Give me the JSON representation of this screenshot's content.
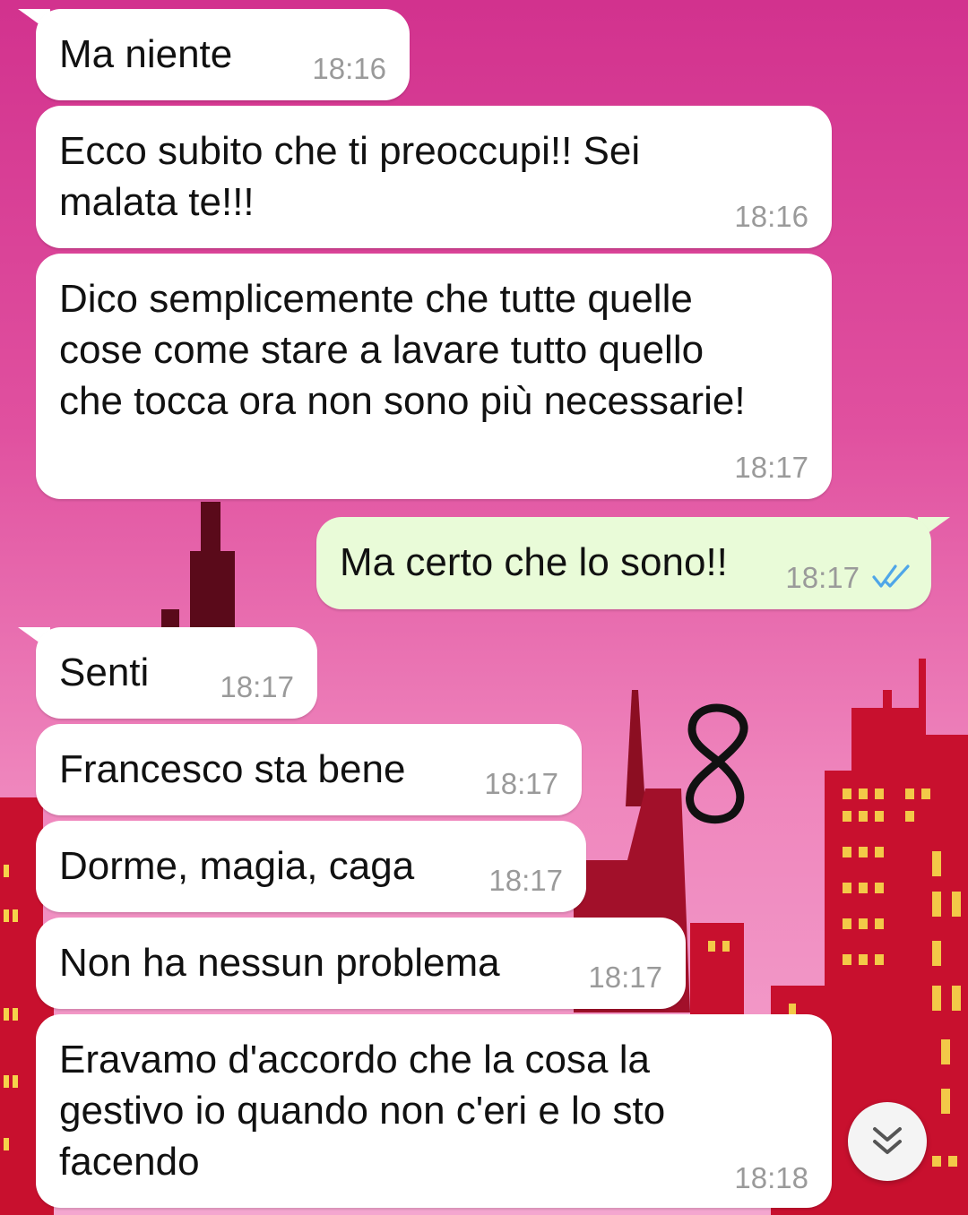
{
  "messages": [
    {
      "text": "Ma niente",
      "time": "18:16",
      "direction": "in"
    },
    {
      "text": "Ecco subito che ti preoccupi!! Sei\nmalata te!!!",
      "time": "18:16",
      "direction": "in"
    },
    {
      "text": "Dico semplicemente che tutte quelle\ncose come stare a lavare tutto quello\nche tocca ora non sono più necessarie!",
      "time": "18:17",
      "direction": "in"
    },
    {
      "text": "Ma certo che lo sono!!",
      "time": "18:17",
      "direction": "out",
      "status": "read"
    },
    {
      "text": "Senti",
      "time": "18:17",
      "direction": "in"
    },
    {
      "text": "Francesco sta bene",
      "time": "18:17",
      "direction": "in"
    },
    {
      "text": "Dorme, magia, caga",
      "time": "18:17",
      "direction": "in"
    },
    {
      "text": "Non ha nessun problema",
      "time": "18:17",
      "direction": "in"
    },
    {
      "text": "Eravamo d'accordo che la cosa la\ngestivo io quando non c'eri e lo sto\nfacendo",
      "time": "18:18",
      "direction": "in"
    }
  ],
  "annotation": {
    "text": "8"
  },
  "scroll_button": {
    "icon": "double-chevron-down-icon"
  },
  "colors": {
    "incoming_bubble": "#ffffff",
    "outgoing_bubble": "#e9fbd8",
    "timestamp": "#9a9a9a",
    "read_ticks": "#4fa6e8",
    "wallpaper_top": "#d2328e",
    "wallpaper_bottom": "#f4a6cf",
    "buildings": "#c8102e"
  }
}
